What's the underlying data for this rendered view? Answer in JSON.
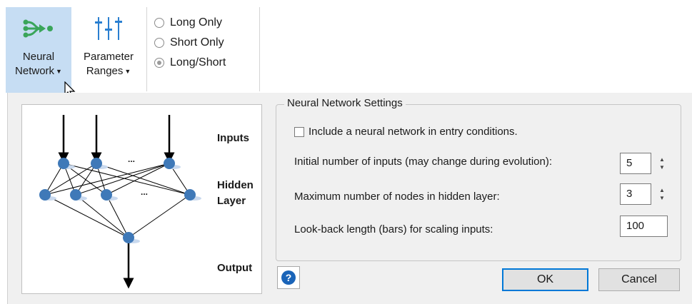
{
  "ribbon": {
    "neural_network": {
      "line1": "Neural",
      "line2": "Network",
      "icon": "neural-network-icon"
    },
    "parameter_ranges": {
      "line1": "Parameter",
      "line2": "Ranges",
      "icon": "sliders-icon"
    },
    "trade_direction": {
      "options": [
        "Long Only",
        "Short Only",
        "Long/Short"
      ],
      "selected": "Long/Short"
    }
  },
  "diagram": {
    "inputs_label": "Inputs",
    "hidden_label_line1": "Hidden",
    "hidden_label_line2": "Layer",
    "output_label": "Output",
    "ellipsis": "..."
  },
  "settings": {
    "group_title": "Neural Network Settings",
    "include_label": "Include a neural network in entry conditions.",
    "include_checked": false,
    "inputs_label": "Initial number of inputs (may change during evolution):",
    "inputs_value": "5",
    "hidden_label": "Maximum number of nodes in hidden layer:",
    "hidden_value": "3",
    "lookback_label": "Look-back length (bars) for scaling inputs:",
    "lookback_value": "100"
  },
  "buttons": {
    "ok": "OK",
    "cancel": "Cancel",
    "help": "?"
  },
  "colors": {
    "accent": "#0078d7",
    "ribbon_selected": "#c6ddf3",
    "icon_green": "#3aa55a",
    "icon_blue": "#2a7fd0",
    "node_blue": "#3f79b8",
    "help_blue": "#1a64b8"
  }
}
